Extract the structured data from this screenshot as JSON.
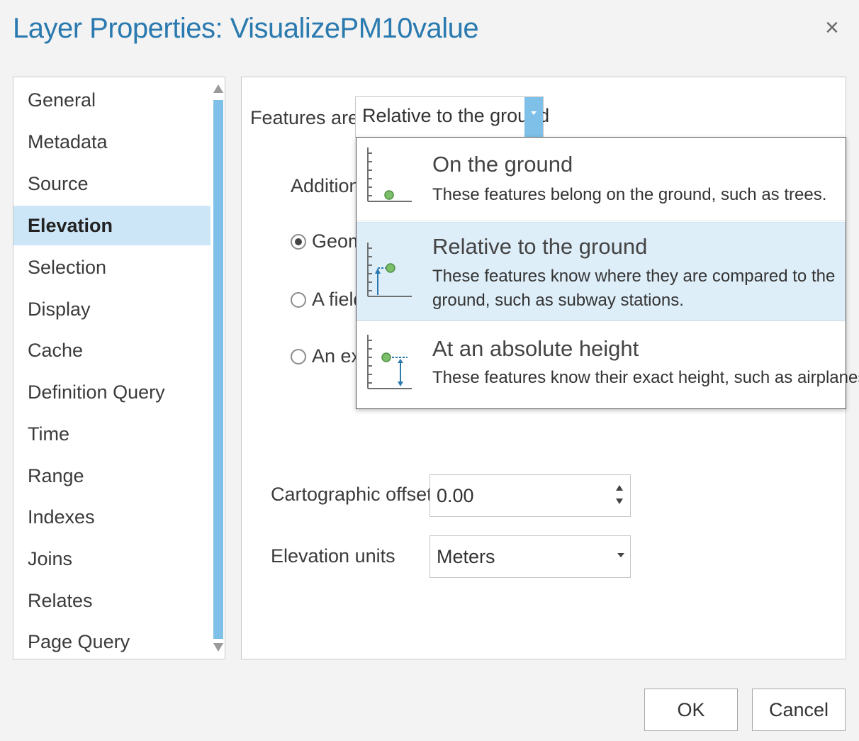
{
  "window": {
    "title": "Layer Properties: VisualizePM10value",
    "close_glyph": "×"
  },
  "nav": {
    "items": [
      {
        "label": "General"
      },
      {
        "label": "Metadata"
      },
      {
        "label": "Source"
      },
      {
        "label": "Elevation",
        "selected": true
      },
      {
        "label": "Selection"
      },
      {
        "label": "Display"
      },
      {
        "label": "Cache"
      },
      {
        "label": "Definition Query"
      },
      {
        "label": "Time"
      },
      {
        "label": "Range"
      },
      {
        "label": "Indexes"
      },
      {
        "label": "Joins"
      },
      {
        "label": "Relates"
      },
      {
        "label": "Page Query"
      }
    ]
  },
  "elevation": {
    "features_are_label": "Features are",
    "features_are_value": "Relative to the ground",
    "additional_label_partial": "Additiona",
    "radio_geometry_partial": "Geom",
    "radio_field_partial": "A field",
    "radio_expression_partial": "An exp",
    "cartographic_offset_label": "Cartographic offset",
    "cartographic_offset_value": "0.00",
    "elevation_units_label": "Elevation units",
    "elevation_units_value": "Meters"
  },
  "dropdown": {
    "options": [
      {
        "title": "On the ground",
        "desc1": "These features belong on the ground, such as trees.",
        "desc2": "",
        "icon": "on-ground-icon"
      },
      {
        "title": "Relative to the ground",
        "desc1": "These features know where they are compared to the",
        "desc2": "ground, such as subway stations.",
        "icon": "relative-ground-icon",
        "highlighted": true
      },
      {
        "title": "At an absolute height",
        "desc1": "These features know their exact height, such as airplanes.",
        "desc2": "",
        "icon": "absolute-height-icon"
      }
    ]
  },
  "buttons": {
    "ok": "OK",
    "cancel": "Cancel"
  },
  "colors": {
    "accent": "#2a7ab0",
    "selected_bg": "#cde6f7",
    "scroll_thumb": "#7fc0e8",
    "highlight_bg": "#deeef9",
    "marker_green": "#7bbf6a"
  }
}
